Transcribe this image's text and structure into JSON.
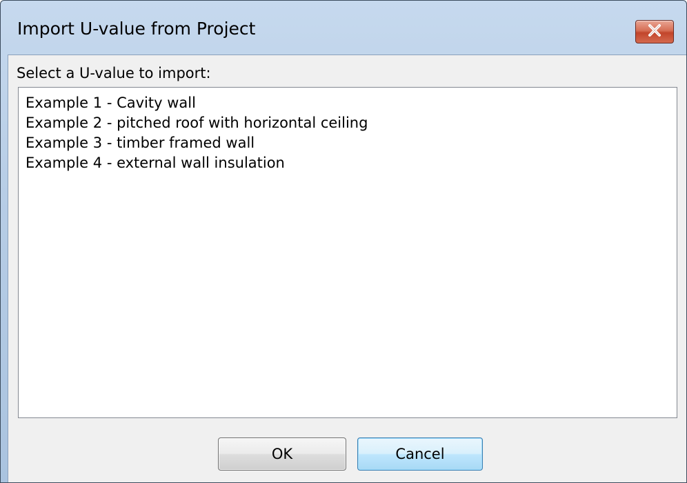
{
  "window": {
    "title": "Import U-value from Project",
    "close_icon": "close-icon"
  },
  "dialog": {
    "prompt": "Select a U-value to import:",
    "items": [
      {
        "label": "Example 1 - Cavity wall"
      },
      {
        "label": "Example 2 - pitched roof with horizontal ceiling"
      },
      {
        "label": "Example 3 - timber framed wall"
      },
      {
        "label": "Example 4 - external wall insulation"
      }
    ]
  },
  "buttons": {
    "ok_label": "OK",
    "cancel_label": "Cancel"
  },
  "colors": {
    "title_bar": "#b9cfe8",
    "close_button": "#c94f35",
    "client_background": "#f0f0f0",
    "focused_button": "#bee6fd"
  }
}
